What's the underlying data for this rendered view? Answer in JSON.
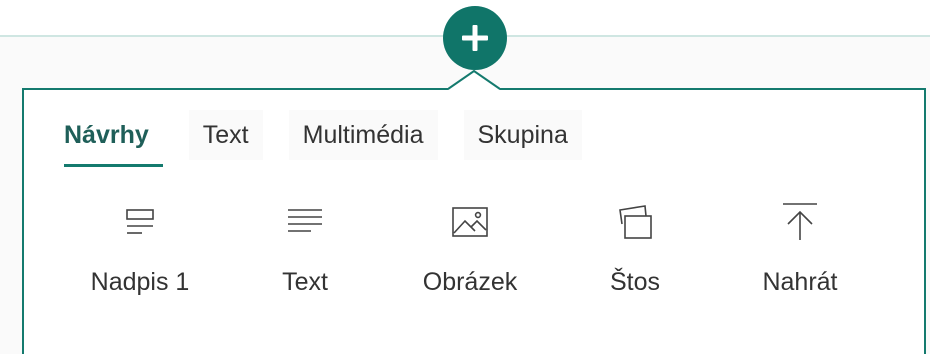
{
  "toolbar": {
    "add_label": "+"
  },
  "tabs": [
    {
      "label": "Návrhy",
      "active": true
    },
    {
      "label": "Text",
      "active": false
    },
    {
      "label": "Multimédia",
      "active": false
    },
    {
      "label": "Skupina",
      "active": false
    }
  ],
  "items": [
    {
      "label": "Nadpis 1",
      "icon": "heading-icon"
    },
    {
      "label": "Text",
      "icon": "text-lines-icon"
    },
    {
      "label": "Obrázek",
      "icon": "image-icon"
    },
    {
      "label": "Štos",
      "icon": "stack-icon"
    },
    {
      "label": "Nahrát",
      "icon": "upload-icon"
    }
  ],
  "colors": {
    "accent": "#147a6e",
    "accent_dark": "#107569",
    "divider": "#cfe6e2",
    "text": "#333333",
    "tab_active_text": "#1f5f59"
  }
}
